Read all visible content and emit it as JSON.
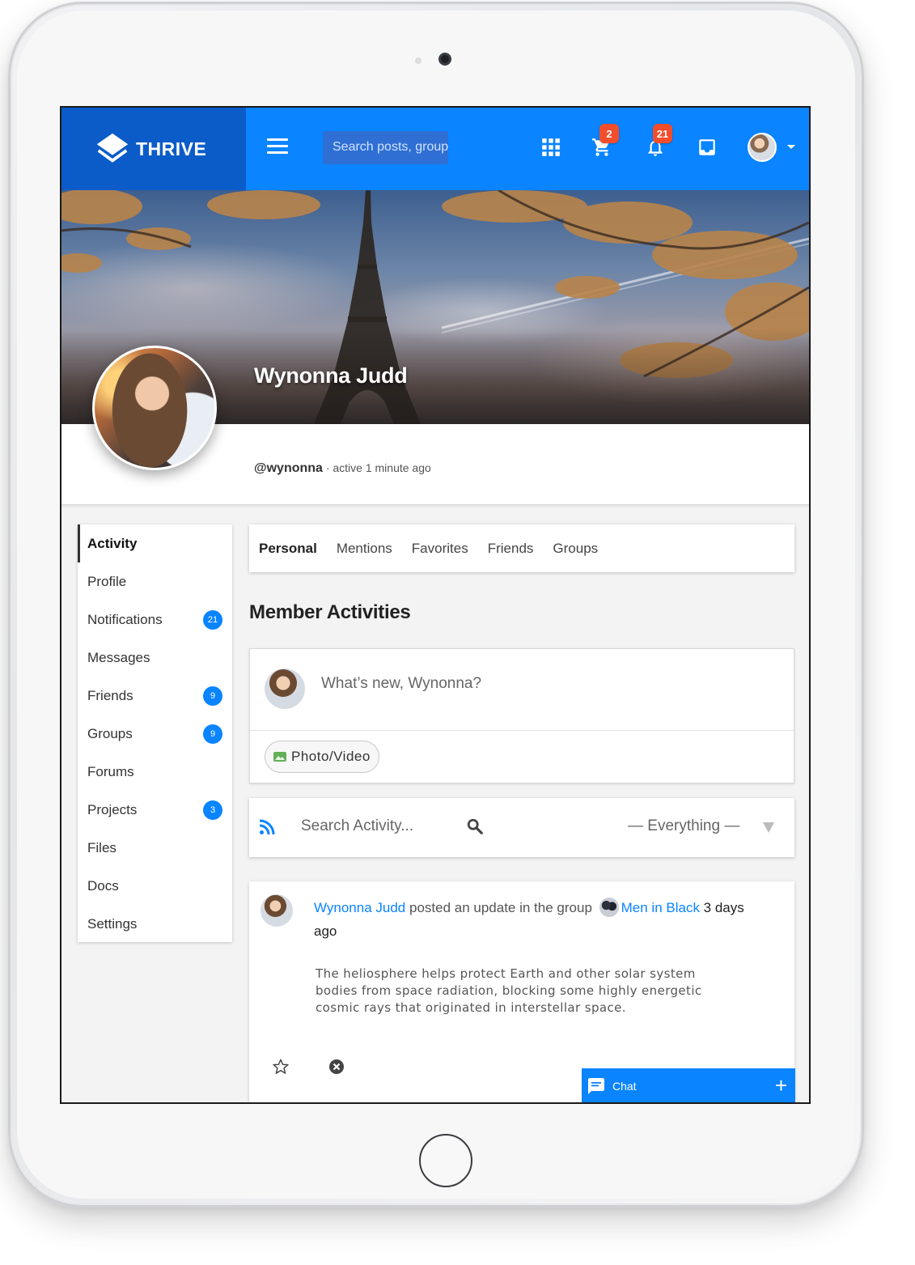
{
  "brand": {
    "name": "THRIVE"
  },
  "topbar": {
    "search_placeholder": "Search posts, groups",
    "cart_count": "2",
    "notification_count": "21"
  },
  "profile": {
    "name": "Wynonna Judd",
    "handle": "@wynonna",
    "status": " · active 1 minute ago"
  },
  "sidebar": {
    "items": [
      {
        "label": "Activity",
        "badge": ""
      },
      {
        "label": "Profile",
        "badge": ""
      },
      {
        "label": "Notifications",
        "badge": "21"
      },
      {
        "label": "Messages",
        "badge": ""
      },
      {
        "label": "Friends",
        "badge": "9"
      },
      {
        "label": "Groups",
        "badge": "9"
      },
      {
        "label": "Forums",
        "badge": ""
      },
      {
        "label": "Projects",
        "badge": "3"
      },
      {
        "label": "Files",
        "badge": ""
      },
      {
        "label": "Docs",
        "badge": ""
      },
      {
        "label": "Settings",
        "badge": ""
      }
    ]
  },
  "tabs": [
    "Personal",
    "Mentions",
    "Favorites",
    "Friends",
    "Groups"
  ],
  "main": {
    "section_title": "Member Activities",
    "composer_placeholder": "What’s new, Wynonna?",
    "photo_button": "Photo/Video",
    "activity_search_placeholder": "Search Activity...",
    "filter_value": "— Everything —"
  },
  "post": {
    "author": "Wynonna Judd",
    "action": " posted an update in the group ",
    "group": "Men in Black",
    "time": " 3 days ago",
    "body": "The heliosphere helps protect Earth and other solar system bodies from space radiation, blocking some highly energetic cosmic rays that originated in interstellar space."
  },
  "chat": {
    "label": "Chat",
    "plus": "+"
  },
  "colors": {
    "primary": "#0a84ff",
    "brand_dark": "#0b5cc9",
    "badge_red": "#f44d2b"
  }
}
